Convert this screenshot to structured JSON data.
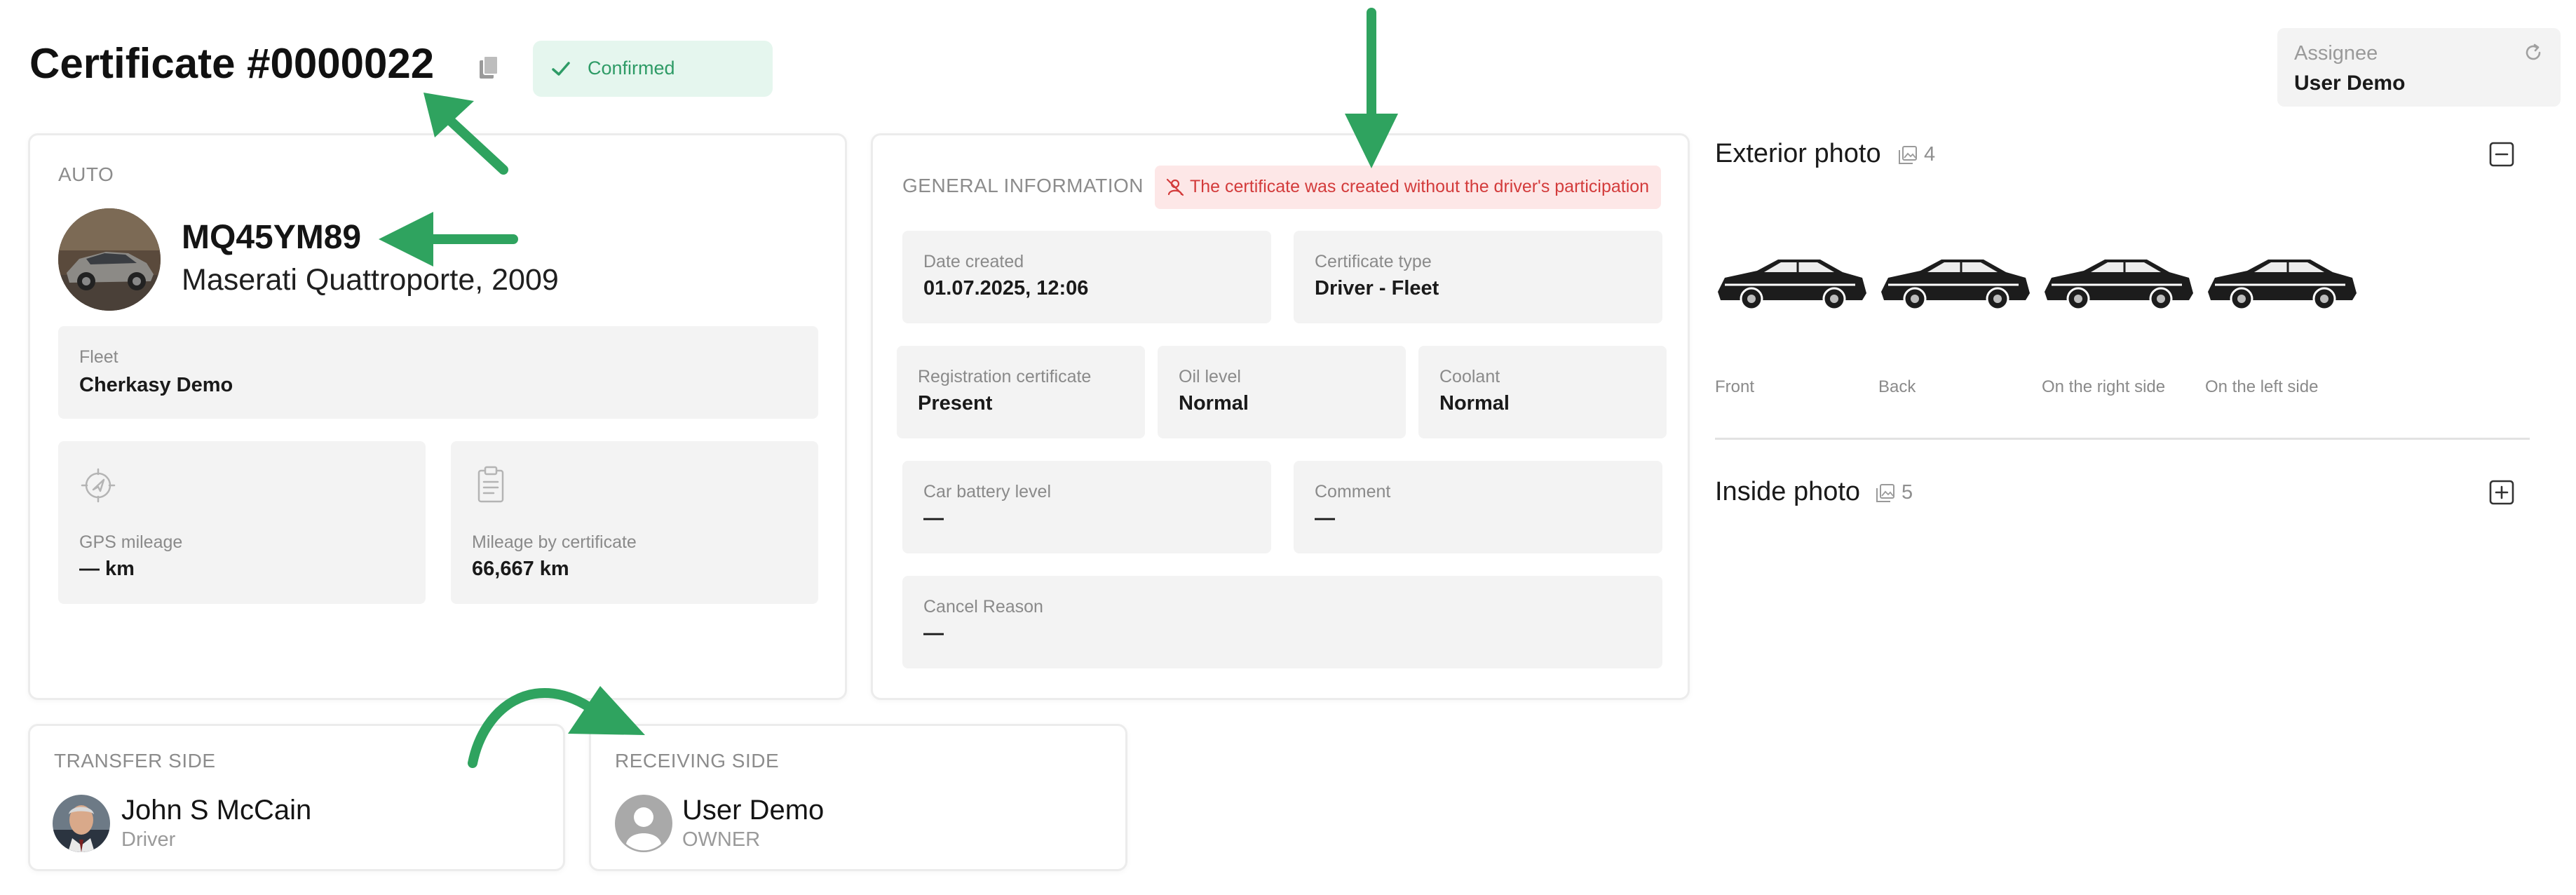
{
  "header": {
    "title": "Certificate #0000022",
    "status": "Confirmed",
    "assignee_label": "Assignee",
    "assignee_name": "User Demo"
  },
  "auto": {
    "section_label": "AUTO",
    "plate": "MQ45YM89",
    "model": "Maserati Quattroporte, 2009",
    "fleet_label": "Fleet",
    "fleet_value": "Cherkasy Demo",
    "gps_label": "GPS mileage",
    "gps_value": "— km",
    "cert_mileage_label": "Mileage by certificate",
    "cert_mileage_value": "66,667 km"
  },
  "general": {
    "section_label": "GENERAL INFORMATION",
    "warning": "The certificate was created without the driver's participation",
    "date_created_label": "Date created",
    "date_created_value": "01.07.2025, 12:06",
    "cert_type_label": "Certificate type",
    "cert_type_value": "Driver - Fleet",
    "reg_cert_label": "Registration certificate",
    "reg_cert_value": "Present",
    "oil_label": "Oil level",
    "oil_value": "Normal",
    "coolant_label": "Coolant",
    "coolant_value": "Normal",
    "battery_label": "Car battery level",
    "battery_value": "—",
    "comment_label": "Comment",
    "comment_value": "—",
    "cancel_label": "Cancel Reason",
    "cancel_value": "—"
  },
  "photos": {
    "exterior_title": "Exterior photo",
    "exterior_count": "4",
    "exterior_items": [
      "Front",
      "Back",
      "On the right side",
      "On the left side"
    ],
    "inside_title": "Inside photo",
    "inside_count": "5"
  },
  "transfer": {
    "section_label": "TRANSFER SIDE",
    "name": "John S McCain",
    "role": "Driver"
  },
  "receiving": {
    "section_label": "RECEIVING SIDE",
    "name": "User Demo",
    "role": "OWNER"
  },
  "colors": {
    "accent_green": "#2fa35f",
    "status_green": "#2e9b66",
    "warning_red": "#d33b3b",
    "tile_bg": "#f3f3f3"
  }
}
